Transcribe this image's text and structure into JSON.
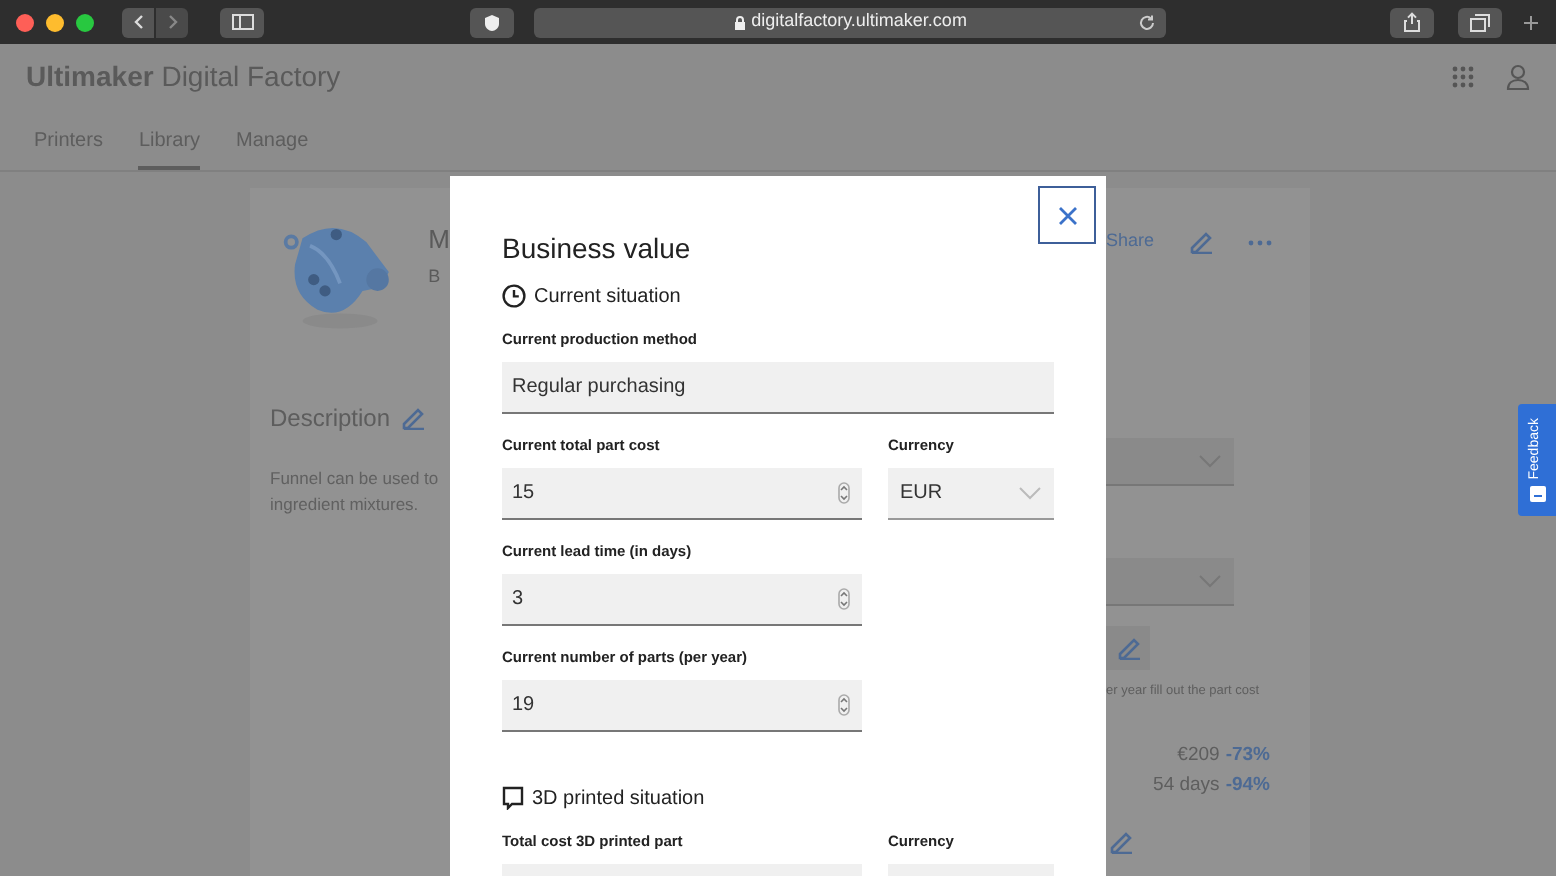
{
  "browser": {
    "url": "digitalfactory.ultimaker.com"
  },
  "app": {
    "brand_bold": "Ultimaker",
    "brand_rest": "Digital Factory",
    "tabs": [
      {
        "label": "Printers",
        "selected": false
      },
      {
        "label": "Library",
        "selected": true
      },
      {
        "label": "Manage",
        "selected": false
      }
    ]
  },
  "background_page": {
    "name_partial": "M",
    "subtitle_partial": "B",
    "share": "Share",
    "description_title": "Description",
    "description_lines": [
      "Funnel can be used to",
      "ingredient mixtures."
    ],
    "cost_hint": "er year fill out the part cost",
    "savings": [
      {
        "value": "€209",
        "change": "-73%"
      },
      {
        "value": "54 days",
        "change": "-94%"
      }
    ]
  },
  "feedback": {
    "label": "Feedback"
  },
  "modal": {
    "title": "Business value",
    "sections": [
      {
        "title": "Current situation",
        "kind": "current",
        "rows": [
          {
            "fields": [
              {
                "label": "Current production method",
                "kind": "text",
                "value": "Regular purchasing"
              }
            ]
          },
          {
            "fields": [
              {
                "label": "Current total part cost",
                "kind": "number",
                "value": "15"
              },
              {
                "label": "Currency",
                "kind": "select",
                "value": "EUR"
              }
            ]
          },
          {
            "fields": [
              {
                "label": "Current lead time (in days)",
                "kind": "number",
                "value": "3"
              }
            ]
          },
          {
            "fields": [
              {
                "label": "Current number of parts (per year)",
                "kind": "number",
                "value": "19"
              }
            ]
          }
        ]
      },
      {
        "title": "3D printed situation",
        "kind": "printed",
        "rows": [
          {
            "fields": [
              {
                "label": "Total cost 3D printed part",
                "kind": "number"
              },
              {
                "label": "Currency",
                "kind": "select"
              }
            ]
          }
        ]
      }
    ]
  }
}
